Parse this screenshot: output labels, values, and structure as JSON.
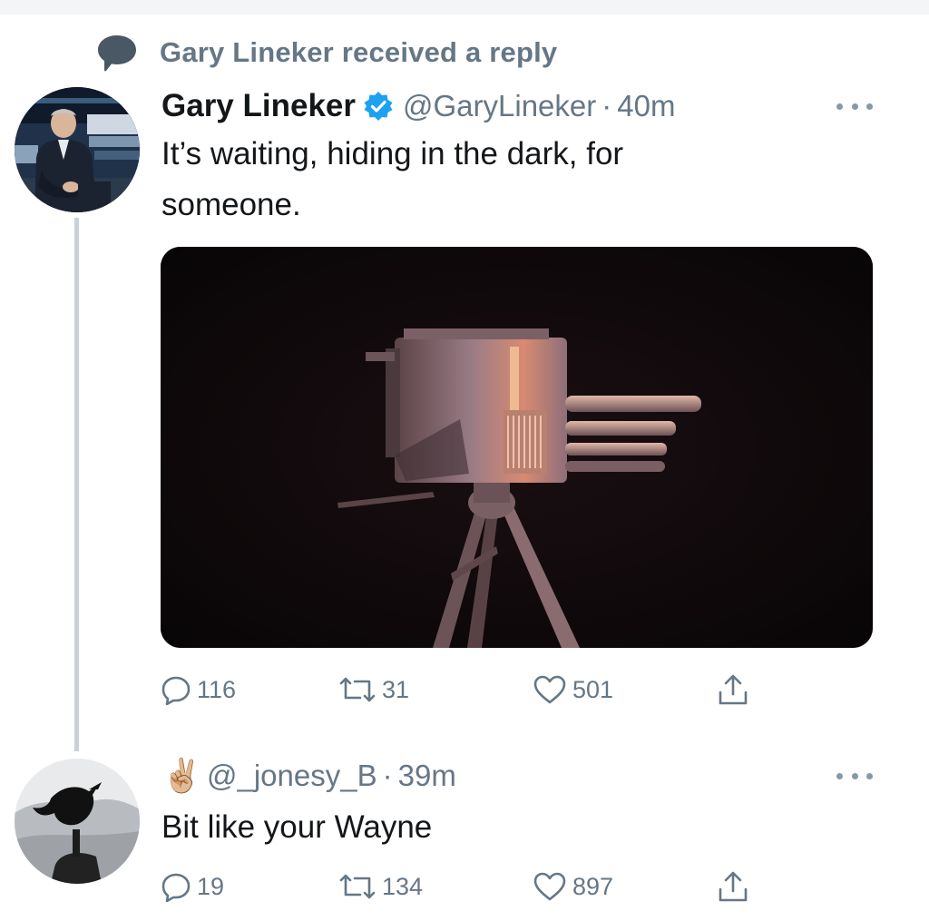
{
  "notice": {
    "text": "Gary Lineker received a reply",
    "icon": "speech-bubble-icon"
  },
  "tweet": {
    "name": "Gary Lineker",
    "verified": true,
    "handle": "@GaryLineker",
    "separator": "·",
    "time": "40m",
    "text": "It’s waiting, hiding in the dark, for someone.",
    "media": "camera-on-tripod-photo",
    "actions": {
      "replies": "116",
      "retweets": "31",
      "likes": "501"
    }
  },
  "reply": {
    "emoji": "✌🏼",
    "handle": "@_jonesy_B",
    "separator": "·",
    "time": "39m",
    "text": "Bit like your Wayne",
    "actions": {
      "replies": "19",
      "retweets": "134",
      "likes": "897"
    }
  },
  "colors": {
    "secondary_text": "#657786",
    "verified_blue": "#1da1f2",
    "thread_line": "#c9d1d8"
  }
}
